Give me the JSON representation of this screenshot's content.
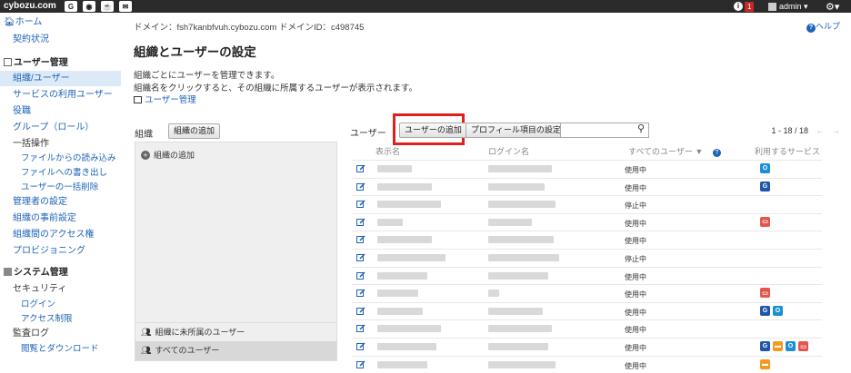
{
  "topbar": {
    "brand": "cybozu.com",
    "apps": [
      {
        "label": "G",
        "icon": "garoon-app-icon"
      },
      {
        "label": "◉",
        "icon": "office-app-icon"
      },
      {
        "label": "☕",
        "icon": "mailwise-app-icon"
      },
      {
        "label": "✉",
        "icon": "mail-app-icon"
      }
    ],
    "info_badge": "1",
    "user": "admin ▾",
    "settings": "⚙▾"
  },
  "sidebar": {
    "home": "ホーム",
    "contract": "契約状況",
    "user_mgmt_header": "ユーザー管理",
    "items": [
      "組織/ユーザー",
      "サービスの利用ユーザー",
      "役職",
      "グループ（ロール）",
      "一括操作",
      "ファイルからの読み込み",
      "ファイルへの書き出し",
      "ユーザーの一括削除",
      "管理者の設定",
      "組織の事前設定",
      "組織間のアクセス権",
      "プロビジョニング"
    ],
    "system_header": "システム管理",
    "system_items": [
      "セキュリティ",
      "ログイン",
      "アクセス制限",
      "監査ログ",
      "閲覧とダウンロード"
    ]
  },
  "main": {
    "domain_line": "ドメイン：fsh7kanbfvuh.cybozu.com  ドメインID：c498745",
    "help": "ヘルプ",
    "title": "組織とユーザーの設定",
    "desc1": "組織ごとにユーザーを管理できます。",
    "desc2": "組織名をクリックすると、その組織に所属するユーザーが表示されます。",
    "desc_link": "ユーザー管理",
    "org_label": "組織",
    "add_org_button": "組織の追加",
    "org_panel_add": "組織の追加",
    "org_unassigned": "組織に未所属のユーザー",
    "org_all_users": "すべてのユーザー",
    "users_label": "ユーザー",
    "add_user_button": "ユーザーの追加",
    "profile_button": "プロフィール項目の設定",
    "search_placeholder": "",
    "pager": "1 - 18 / 18",
    "columns": {
      "display_name": "表示名",
      "login_name": "ログイン名",
      "all_users": "すべてのユーザー ▼",
      "services": "利用するサービス"
    },
    "rows": [
      {
        "status": "使用中",
        "services": [
          "office"
        ]
      },
      {
        "status": "使用中",
        "services": [
          "garoon"
        ]
      },
      {
        "status": "停止中",
        "services": []
      },
      {
        "status": "使用中",
        "services": [
          "mailwise"
        ]
      },
      {
        "status": "使用中",
        "services": []
      },
      {
        "status": "停止中",
        "services": []
      },
      {
        "status": "使用中",
        "services": []
      },
      {
        "status": "使用中",
        "services": [
          "mailwise"
        ]
      },
      {
        "status": "使用中",
        "services": [
          "garoon",
          "office"
        ]
      },
      {
        "status": "使用中",
        "services": []
      },
      {
        "status": "使用中",
        "services": [
          "garoon",
          "kintone",
          "office",
          "mailwise"
        ]
      },
      {
        "status": "使用中",
        "services": [
          "kintone"
        ]
      }
    ]
  },
  "colors": {
    "link": "#1e63b8",
    "highlight": "#e0201b",
    "topbar": "#2b2b2b",
    "garoon": "#1e56a8",
    "office": "#1b8fd6",
    "mailwise": "#e2574c",
    "kintone": "#f39a1e"
  }
}
